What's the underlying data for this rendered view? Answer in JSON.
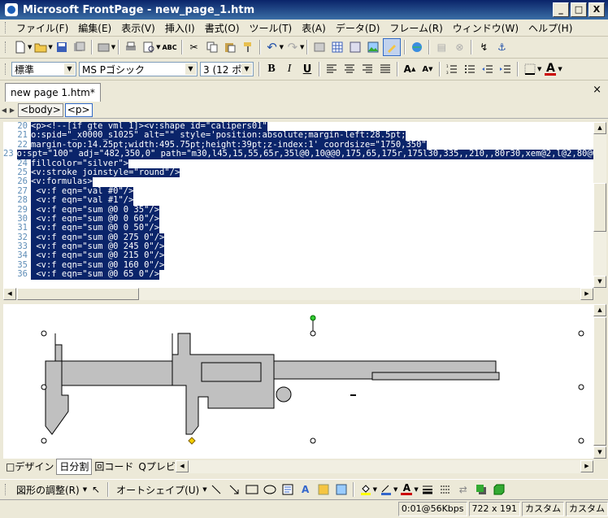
{
  "window": {
    "title": "Microsoft FrontPage - new_page_1.htm",
    "minimize": "_",
    "maximize": "□",
    "close": "X"
  },
  "menu": [
    "ファイル(F)",
    "編集(E)",
    "表示(V)",
    "挿入(I)",
    "書式(O)",
    "ツール(T)",
    "表(A)",
    "データ(D)",
    "フレーム(R)",
    "ウィンドウ(W)",
    "ヘルプ(H)"
  ],
  "format_toolbar": {
    "style_value": "標準",
    "font_value": "MS Pゴシック",
    "size_value": "3 (12 ポ",
    "bold": "B",
    "italic": "I",
    "underline": "U"
  },
  "tabs": {
    "document_tab": "new page 1.htm*",
    "close": "×"
  },
  "tag_selector": [
    "<body>",
    "<p>"
  ],
  "code": {
    "lines": [
      {
        "num": "20",
        "text": "<p><!--[if gte vml 1]><v:shape id=\"calipers01\""
      },
      {
        "num": "21",
        "text": "o:spid=\"_x0000_s1025\" alt=\"\" style='position:absolute;margin-left:28.5pt;"
      },
      {
        "num": "22",
        "text": "margin-top:14.25pt;width:495.75pt;height:39pt;z-index:1' coordsize=\"1750,350\""
      },
      {
        "num": "23",
        "text": "o:spt=\"100\" adj=\"482,350,0\" path=\"m30,l45,15,55,65r,35l@0,10@@0,175,65,175r,175l30,335,,210,,80r30,xem@2,l@2,80@0,"
      },
      {
        "num": "24",
        "text": "fillcolor=\"silver\">"
      },
      {
        "num": "25",
        "text": "<v:stroke joinstyle=\"round\"/>"
      },
      {
        "num": "26",
        "text": "<v:formulas>"
      },
      {
        "num": "27",
        "text": " <v:f eqn=\"val #0\"/>"
      },
      {
        "num": "28",
        "text": " <v:f eqn=\"val #1\"/>"
      },
      {
        "num": "29",
        "text": " <v:f eqn=\"sum @0 0 35\"/>"
      },
      {
        "num": "30",
        "text": " <v:f eqn=\"sum @0 0 60\"/>"
      },
      {
        "num": "31",
        "text": " <v:f eqn=\"sum @0 0 50\"/>"
      },
      {
        "num": "32",
        "text": " <v:f eqn=\"sum @0 275 0\"/>"
      },
      {
        "num": "33",
        "text": " <v:f eqn=\"sum @0 245 0\"/>"
      },
      {
        "num": "34",
        "text": " <v:f eqn=\"sum @0 215 0\"/>"
      },
      {
        "num": "35",
        "text": " <v:f eqn=\"sum @0 160 0\"/>"
      },
      {
        "num": "36",
        "text": " <v:f eqn=\"sum @0 65 0\"/>"
      }
    ]
  },
  "view_tabs": [
    "デザイン",
    "分割",
    "コード",
    "プレビュー"
  ],
  "view_tab_glyphs": [
    "□",
    "日",
    "回",
    "Q"
  ],
  "draw_toolbar": {
    "adjust_label": "図形の調整(R)",
    "autoshapes_label": "オートシェイプ(U)"
  },
  "status": {
    "connection": "0:01@56Kbps",
    "dimensions": "722 x 191",
    "mode1": "カスタム",
    "mode2": "カスタム"
  },
  "colors": {
    "titlebar": "#0a246a",
    "selection": "#0a246a",
    "shape_fill": "#c0c0c0",
    "line_numbers": "#5e8db7"
  }
}
